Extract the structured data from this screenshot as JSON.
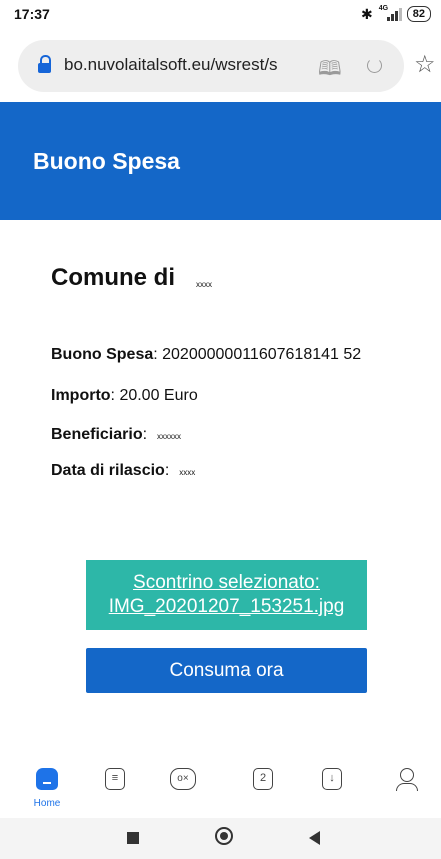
{
  "status_bar": {
    "time": "17:37",
    "network": "4G",
    "battery": "82"
  },
  "browser": {
    "url": "bo.nuvolaitalsoft.eu/wsrest/s",
    "bottom_nav": {
      "home_label": "Home",
      "tab_count": "2"
    }
  },
  "header": {
    "title": "Buono Spesa"
  },
  "main": {
    "comune_label": "Comune di",
    "comune_name": "xxxx",
    "buono_label": "Buono Spesa",
    "buono_value": ": 20200000011607618141 52",
    "importo_label": "Importo",
    "importo_value": ": 20.00 Euro",
    "beneficiario_label": "Beneficiario",
    "beneficiario_sep": ":",
    "beneficiario_value": "xxxxxx",
    "rilascio_label": "Data di rilascio",
    "rilascio_sep": ":",
    "rilascio_value": "xxxx",
    "receipt_line1": "Scontrino selezionato:",
    "receipt_line2": "IMG_20201207_153251.jpg",
    "consume_label": "Consuma ora"
  },
  "colors": {
    "primary": "#1467c8",
    "accent": "#2db7a8"
  }
}
